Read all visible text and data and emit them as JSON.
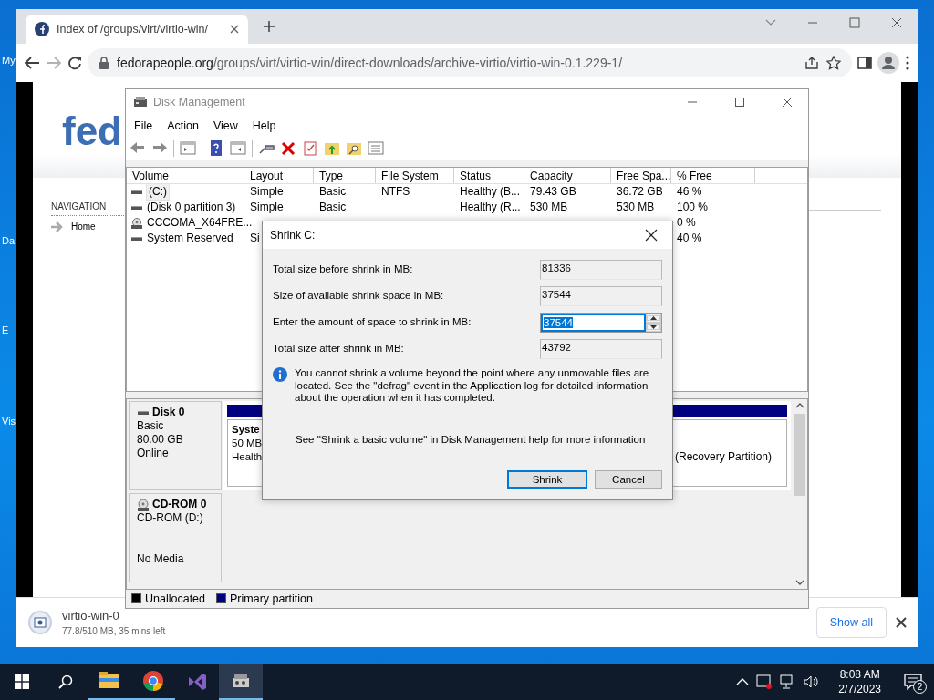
{
  "desktop": {
    "icon_labels": [
      "My",
      "Da",
      "E",
      "Vis"
    ]
  },
  "browser": {
    "tabs": [
      {
        "title": "Index of /groups/virt/virtio-win/"
      }
    ],
    "url_host": "fedorapeople.org",
    "url_path": "/groups/virt/virtio-win/direct-downloads/archive-virtio/virtio-win-0.1.229-1/"
  },
  "web_page": {
    "logo": "fed",
    "navigation_heading": "NAVIGATION",
    "links": [
      "Home"
    ]
  },
  "downloads": {
    "items": [
      {
        "file": "virtio-win-0",
        "progress": "77.8/510 MB, 35 mins left"
      }
    ],
    "show_all": "Show all"
  },
  "disk_management": {
    "title": "Disk Management",
    "menu": [
      "File",
      "Action",
      "View",
      "Help"
    ],
    "columns": [
      "Volume",
      "Layout",
      "Type",
      "File System",
      "Status",
      "Capacity",
      "Free Spa...",
      "% Free"
    ],
    "volumes": [
      {
        "kind": "disk",
        "selected": true,
        "volume": "(C:)",
        "layout": "Simple",
        "type": "Basic",
        "file_system": "NTFS",
        "status": "Healthy (B...",
        "capacity": "79.43 GB",
        "free_space": "36.72 GB",
        "percent_free": "46 %"
      },
      {
        "kind": "disk",
        "selected": false,
        "volume": "(Disk 0 partition 3)",
        "layout": "Simple",
        "type": "Basic",
        "status": "Healthy (R...",
        "capacity": "530 MB",
        "free_space": "530 MB",
        "percent_free": "100 %"
      },
      {
        "kind": "cd",
        "selected": false,
        "volume": "CCCOMA_X64FRE...",
        "percent_free": "0 %"
      },
      {
        "kind": "disk",
        "selected": false,
        "volume": "System Reserved",
        "layout": "Si",
        "percent_free": "40 %"
      }
    ],
    "disks": [
      {
        "kind": "disk",
        "name": "Disk 0",
        "type": "Basic",
        "size": "80.00 GB",
        "status": "Online",
        "partitions": [
          {
            "name": "Syste",
            "size": "50 MB",
            "status": "Health"
          },
          {
            "status": "(Recovery Partition)"
          }
        ]
      },
      {
        "kind": "cd",
        "name": "CD-ROM 0",
        "type": "CD-ROM (D:)",
        "status": "No Media"
      }
    ],
    "legend": [
      {
        "label": "Unallocated",
        "color": "#000000"
      },
      {
        "label": "Primary partition",
        "color": "#000080"
      }
    ]
  },
  "dialog": {
    "title": "Shrink C:",
    "fields": [
      {
        "kind": "readonly",
        "label": "Total size before shrink in MB:",
        "value": "81336",
        "text_selected": false
      },
      {
        "kind": "readonly",
        "label": "Size of available shrink space in MB:",
        "value": "37544",
        "text_selected": false
      },
      {
        "kind": "spin",
        "label": "Enter the amount of space to shrink in MB:",
        "value": "37544",
        "text_selected": true
      },
      {
        "kind": "readonly",
        "label": "Total size after shrink in MB:",
        "value": "43792",
        "text_selected": false
      }
    ],
    "info": "You cannot shrink a volume beyond the point where any unmovable files are located. See the \"defrag\" event in the Application log for detailed information about the operation when it has completed.",
    "help": "See \"Shrink a basic volume\" in Disk Management help for more information",
    "buttons": [
      {
        "label": "Shrink",
        "default": true
      },
      {
        "label": "Cancel",
        "default": false
      }
    ]
  },
  "taskbar": {
    "apps": [
      {
        "kind": "explorer",
        "running": true,
        "focused": false
      },
      {
        "kind": "chrome",
        "running": true,
        "focused": false
      },
      {
        "kind": "studio",
        "running": false,
        "focused": false
      },
      {
        "kind": "disk-tool",
        "running": true,
        "focused": true
      }
    ],
    "clock": {
      "time": "8:08 AM",
      "date": "2/7/2023"
    },
    "notifications": "2"
  }
}
